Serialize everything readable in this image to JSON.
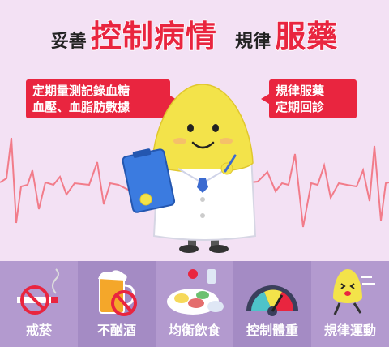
{
  "headline": {
    "part1": "妥善",
    "part2": "控制病情",
    "part3": "規律",
    "part4": "服藥"
  },
  "callout_left": {
    "line1": "定期量測記錄血糖",
    "line2": "血壓、血脂肪數據"
  },
  "callout_right": {
    "line1": "規律服藥",
    "line2": "定期回診"
  },
  "colors": {
    "background": "#f3e1f4",
    "accent_red": "#e9253f",
    "bar_purple": "#b39acf",
    "bar_purple_alt": "#a48bc4",
    "mascot_yellow": "#f3e34a"
  },
  "tiles": [
    {
      "label": "戒菸",
      "icon": "no-smoking-icon"
    },
    {
      "label": "不酗酒",
      "icon": "no-beer-icon"
    },
    {
      "label": "均衡飲食",
      "icon": "food-plate-icon"
    },
    {
      "label": "控制體重",
      "icon": "scale-gauge-icon"
    },
    {
      "label": "規律運動",
      "icon": "running-mascot-icon"
    }
  ]
}
